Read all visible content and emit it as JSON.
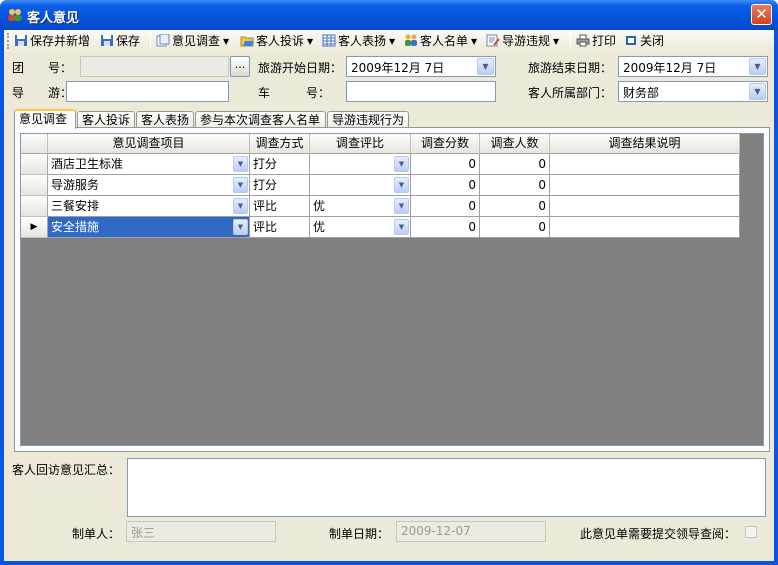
{
  "window": {
    "title": "客人意见",
    "close_glyph": "✕"
  },
  "toolbar": {
    "save_new": "保存并新增",
    "save": "保存",
    "survey": "意见调查",
    "complaint": "客人投诉",
    "praise": "客人表扬",
    "guest_list": "客人名单",
    "guide_violation": "导游违规",
    "print": "打印",
    "close": "关闭"
  },
  "form": {
    "group_no_label": "团　　号：",
    "group_no_value": "",
    "ellipsis": "...",
    "start_date_label": "旅游开始日期：",
    "start_date_value": "2009年12月 7日",
    "end_date_label": "旅游结束日期：",
    "end_date_value": "2009年12月 7日",
    "guide_label": "导　　游：",
    "guide_value": "",
    "car_label": "车　　　号：",
    "car_value": "",
    "dept_label": "客人所属部门：",
    "dept_value": "财务部"
  },
  "tabs": [
    "意见调查",
    "客人投诉",
    "客人表扬",
    "参与本次调查客人名单",
    "导游违规行为"
  ],
  "grid": {
    "columns": [
      "意见调查项目",
      "调查方式",
      "调查评比",
      "调查分数",
      "调查人数",
      "调查结果说明"
    ],
    "rows": [
      {
        "item": "酒店卫生标准",
        "method": "打分",
        "rating": "",
        "score": "0",
        "count": "0",
        "note": ""
      },
      {
        "item": "导游服务",
        "method": "打分",
        "rating": "",
        "score": "0",
        "count": "0",
        "note": ""
      },
      {
        "item": "三餐安排",
        "method": "评比",
        "rating": "优",
        "score": "0",
        "count": "0",
        "note": ""
      },
      {
        "item": "安全措施",
        "method": "评比",
        "rating": "优",
        "score": "0",
        "count": "0",
        "note": ""
      }
    ],
    "current_row_marker": "▶"
  },
  "summary_label": "客人回访意见汇总：",
  "summary_value": "",
  "footer": {
    "maker_label": "制单人：",
    "maker_value": "张三",
    "date_label": "制单日期：",
    "date_value": "2009-12-07",
    "review_label": "此意见单需要提交领导查阅："
  },
  "colors": {
    "title_bar": "#0454db",
    "selection": "#316ac5",
    "grid_background": "#808080",
    "form_background": "#ece9d8"
  }
}
